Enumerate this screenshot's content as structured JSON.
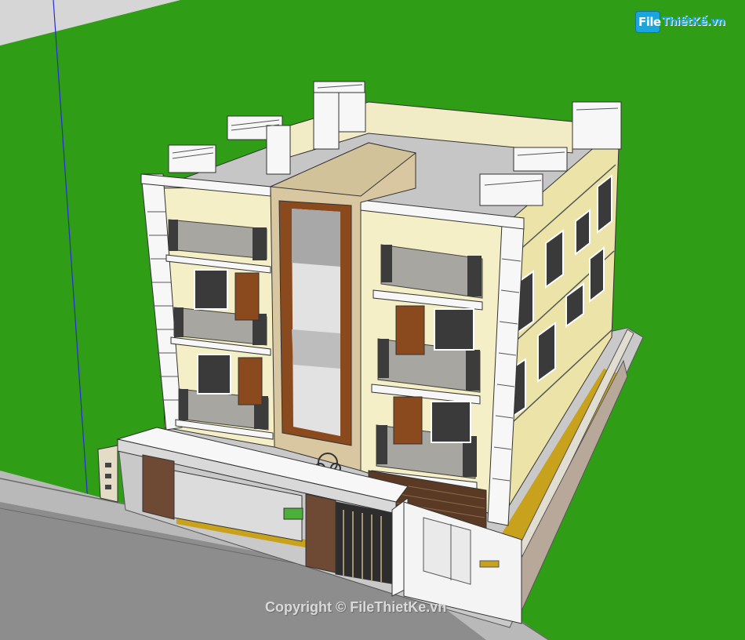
{
  "watermark": {
    "logo_file": "File",
    "logo_rest": "ThiếtKế.vn",
    "copyright": "Copyright © FileThietKe.vn"
  },
  "colors": {
    "grass": "#2f9e16",
    "ground_grey": "#c9c9c9",
    "road": "#8d8d8d",
    "wall_cream": "#f4efc6",
    "wall_side": "#ebe3a8",
    "roof_grey": "#c6c6c6",
    "stair_tower": "#d8c7a0",
    "glass_strip": "#c8c8c8",
    "wood": "#8b4a1d",
    "brick_pillar": "#6e4a34",
    "white_trim": "#f7f7f7",
    "railing": "#3c3c3c"
  }
}
